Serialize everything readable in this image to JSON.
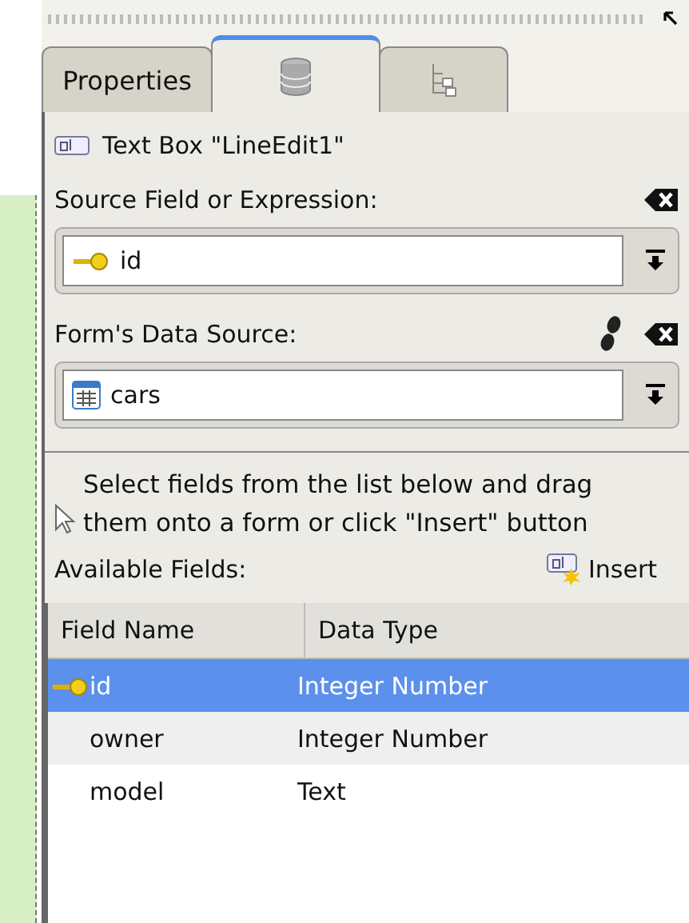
{
  "tabs": [
    {
      "kind": "text",
      "label": "Properties",
      "selected": false
    },
    {
      "kind": "database",
      "selected": true
    },
    {
      "kind": "tree",
      "selected": false
    }
  ],
  "widget": {
    "label": "Text Box \"LineEdit1\""
  },
  "source_field": {
    "label": "Source Field or Expression:",
    "value": "id"
  },
  "data_source": {
    "label": "Form's Data Source:",
    "value": "cars"
  },
  "hint": "Select fields from the list below and drag them onto a form or click \"Insert\" button",
  "available_fields": {
    "label": "Available Fields:",
    "insert_button": "Insert"
  },
  "table": {
    "columns": [
      "Field Name",
      "Data Type"
    ],
    "rows": [
      {
        "name": "id",
        "type": "Integer Number",
        "primary_key": true,
        "selected": true
      },
      {
        "name": "owner",
        "type": "Integer Number",
        "primary_key": false,
        "selected": false
      },
      {
        "name": "model",
        "type": "Text",
        "primary_key": false,
        "selected": false
      }
    ]
  }
}
